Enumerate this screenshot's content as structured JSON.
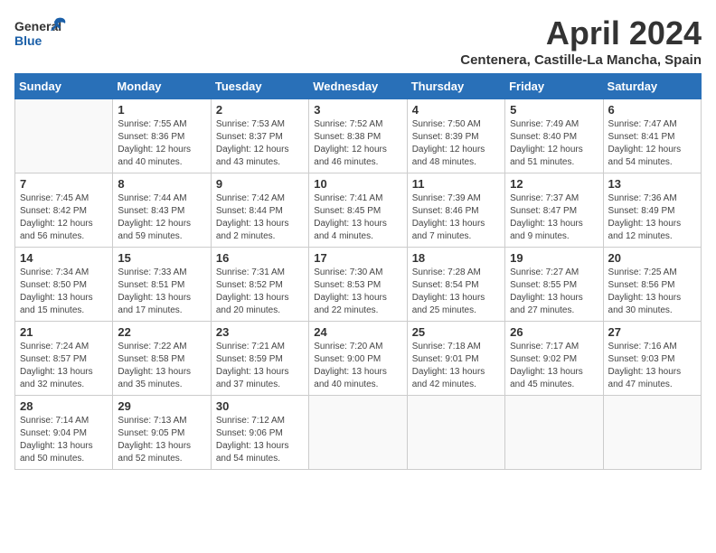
{
  "header": {
    "logo_general": "General",
    "logo_blue": "Blue",
    "month_year": "April 2024",
    "location": "Centenera, Castille-La Mancha, Spain"
  },
  "weekdays": [
    "Sunday",
    "Monday",
    "Tuesday",
    "Wednesday",
    "Thursday",
    "Friday",
    "Saturday"
  ],
  "weeks": [
    [
      {
        "day": "",
        "info": ""
      },
      {
        "day": "1",
        "info": "Sunrise: 7:55 AM\nSunset: 8:36 PM\nDaylight: 12 hours\nand 40 minutes."
      },
      {
        "day": "2",
        "info": "Sunrise: 7:53 AM\nSunset: 8:37 PM\nDaylight: 12 hours\nand 43 minutes."
      },
      {
        "day": "3",
        "info": "Sunrise: 7:52 AM\nSunset: 8:38 PM\nDaylight: 12 hours\nand 46 minutes."
      },
      {
        "day": "4",
        "info": "Sunrise: 7:50 AM\nSunset: 8:39 PM\nDaylight: 12 hours\nand 48 minutes."
      },
      {
        "day": "5",
        "info": "Sunrise: 7:49 AM\nSunset: 8:40 PM\nDaylight: 12 hours\nand 51 minutes."
      },
      {
        "day": "6",
        "info": "Sunrise: 7:47 AM\nSunset: 8:41 PM\nDaylight: 12 hours\nand 54 minutes."
      }
    ],
    [
      {
        "day": "7",
        "info": "Sunrise: 7:45 AM\nSunset: 8:42 PM\nDaylight: 12 hours\nand 56 minutes."
      },
      {
        "day": "8",
        "info": "Sunrise: 7:44 AM\nSunset: 8:43 PM\nDaylight: 12 hours\nand 59 minutes."
      },
      {
        "day": "9",
        "info": "Sunrise: 7:42 AM\nSunset: 8:44 PM\nDaylight: 13 hours\nand 2 minutes."
      },
      {
        "day": "10",
        "info": "Sunrise: 7:41 AM\nSunset: 8:45 PM\nDaylight: 13 hours\nand 4 minutes."
      },
      {
        "day": "11",
        "info": "Sunrise: 7:39 AM\nSunset: 8:46 PM\nDaylight: 13 hours\nand 7 minutes."
      },
      {
        "day": "12",
        "info": "Sunrise: 7:37 AM\nSunset: 8:47 PM\nDaylight: 13 hours\nand 9 minutes."
      },
      {
        "day": "13",
        "info": "Sunrise: 7:36 AM\nSunset: 8:49 PM\nDaylight: 13 hours\nand 12 minutes."
      }
    ],
    [
      {
        "day": "14",
        "info": "Sunrise: 7:34 AM\nSunset: 8:50 PM\nDaylight: 13 hours\nand 15 minutes."
      },
      {
        "day": "15",
        "info": "Sunrise: 7:33 AM\nSunset: 8:51 PM\nDaylight: 13 hours\nand 17 minutes."
      },
      {
        "day": "16",
        "info": "Sunrise: 7:31 AM\nSunset: 8:52 PM\nDaylight: 13 hours\nand 20 minutes."
      },
      {
        "day": "17",
        "info": "Sunrise: 7:30 AM\nSunset: 8:53 PM\nDaylight: 13 hours\nand 22 minutes."
      },
      {
        "day": "18",
        "info": "Sunrise: 7:28 AM\nSunset: 8:54 PM\nDaylight: 13 hours\nand 25 minutes."
      },
      {
        "day": "19",
        "info": "Sunrise: 7:27 AM\nSunset: 8:55 PM\nDaylight: 13 hours\nand 27 minutes."
      },
      {
        "day": "20",
        "info": "Sunrise: 7:25 AM\nSunset: 8:56 PM\nDaylight: 13 hours\nand 30 minutes."
      }
    ],
    [
      {
        "day": "21",
        "info": "Sunrise: 7:24 AM\nSunset: 8:57 PM\nDaylight: 13 hours\nand 32 minutes."
      },
      {
        "day": "22",
        "info": "Sunrise: 7:22 AM\nSunset: 8:58 PM\nDaylight: 13 hours\nand 35 minutes."
      },
      {
        "day": "23",
        "info": "Sunrise: 7:21 AM\nSunset: 8:59 PM\nDaylight: 13 hours\nand 37 minutes."
      },
      {
        "day": "24",
        "info": "Sunrise: 7:20 AM\nSunset: 9:00 PM\nDaylight: 13 hours\nand 40 minutes."
      },
      {
        "day": "25",
        "info": "Sunrise: 7:18 AM\nSunset: 9:01 PM\nDaylight: 13 hours\nand 42 minutes."
      },
      {
        "day": "26",
        "info": "Sunrise: 7:17 AM\nSunset: 9:02 PM\nDaylight: 13 hours\nand 45 minutes."
      },
      {
        "day": "27",
        "info": "Sunrise: 7:16 AM\nSunset: 9:03 PM\nDaylight: 13 hours\nand 47 minutes."
      }
    ],
    [
      {
        "day": "28",
        "info": "Sunrise: 7:14 AM\nSunset: 9:04 PM\nDaylight: 13 hours\nand 50 minutes."
      },
      {
        "day": "29",
        "info": "Sunrise: 7:13 AM\nSunset: 9:05 PM\nDaylight: 13 hours\nand 52 minutes."
      },
      {
        "day": "30",
        "info": "Sunrise: 7:12 AM\nSunset: 9:06 PM\nDaylight: 13 hours\nand 54 minutes."
      },
      {
        "day": "",
        "info": ""
      },
      {
        "day": "",
        "info": ""
      },
      {
        "day": "",
        "info": ""
      },
      {
        "day": "",
        "info": ""
      }
    ]
  ]
}
